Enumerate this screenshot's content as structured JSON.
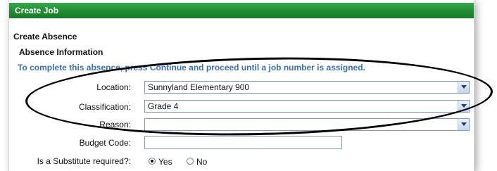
{
  "header": {
    "title": "Create Job"
  },
  "section": {
    "title": "Create Absence",
    "subtitle": "Absence Information"
  },
  "instruction": "To complete this absence, press Continue and proceed until a job number is assigned.",
  "form": {
    "location": {
      "label": "Location:",
      "value": "Sunnyland Elementary 900"
    },
    "classification": {
      "label": "Classification:",
      "value": "Grade 4"
    },
    "reason": {
      "label": "Reason:",
      "value": ""
    },
    "budget_code": {
      "label": "Budget Code:",
      "value": ""
    },
    "substitute": {
      "label": "Is a Substitute required?:",
      "yes_label": "Yes",
      "no_label": "No",
      "selected": "Yes"
    }
  },
  "colors": {
    "header_bg": "#1e8a30",
    "instruction_text": "#3a6fb0"
  }
}
